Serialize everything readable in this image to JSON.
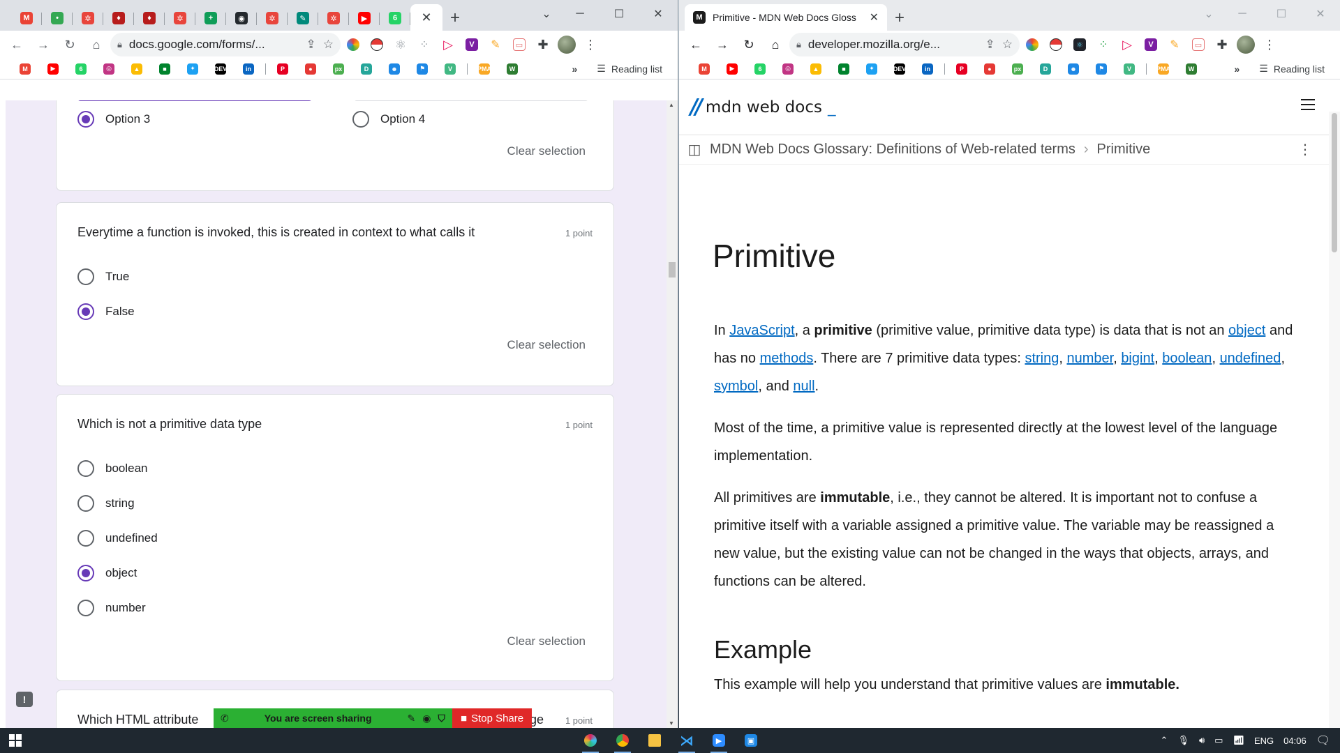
{
  "left_window": {
    "pinned_tabs": [
      {
        "icon": "gmail-icon",
        "color": "#ea4335",
        "glyph": "M"
      },
      {
        "icon": "toggle-icon",
        "color": "#34a853",
        "glyph": "•"
      },
      {
        "icon": "ring-icon",
        "color": "#e8453c",
        "glyph": "✲"
      },
      {
        "icon": "pin-icon",
        "color": "#b71c1c",
        "glyph": "♦"
      },
      {
        "icon": "pin-icon",
        "color": "#b71c1c",
        "glyph": "♦"
      },
      {
        "icon": "ring-icon",
        "color": "#e8453c",
        "glyph": "✲"
      },
      {
        "icon": "sheets-icon",
        "color": "#0f9d58",
        "glyph": "+"
      },
      {
        "icon": "github-icon",
        "color": "#24292e",
        "glyph": "◉"
      },
      {
        "icon": "ring-icon",
        "color": "#e8453c",
        "glyph": "✲"
      },
      {
        "icon": "edit-icon",
        "color": "#00897b",
        "glyph": "✎"
      },
      {
        "icon": "ring-icon",
        "color": "#e8453c",
        "glyph": "✲"
      },
      {
        "icon": "youtube-icon",
        "color": "#ff0000",
        "glyph": "▶"
      },
      {
        "icon": "whatsapp-icon",
        "color": "#25d366",
        "glyph": "6"
      }
    ],
    "url": "docs.google.com/forms/...",
    "reading_list": "Reading list"
  },
  "bookmarks": [
    {
      "icon": "gmail-icon",
      "color": "#ea4335",
      "glyph": "M"
    },
    {
      "icon": "youtube-icon",
      "color": "#ff0000",
      "glyph": "▶"
    },
    {
      "icon": "whatsapp-icon",
      "color": "#25d366",
      "glyph": "6"
    },
    {
      "icon": "instagram-icon",
      "color": "#c13584",
      "glyph": "◎"
    },
    {
      "icon": "drive-icon",
      "color": "#fbbc04",
      "glyph": "▲"
    },
    {
      "icon": "meet-icon",
      "color": "#00832d",
      "glyph": "■"
    },
    {
      "icon": "twitter-icon",
      "color": "#1da1f2",
      "glyph": "✦"
    },
    {
      "icon": "dev-icon",
      "color": "#000000",
      "glyph": "DEV"
    },
    {
      "icon": "linkedin-icon",
      "color": "#0a66c2",
      "glyph": "in"
    },
    {
      "icon": "pinterest-icon",
      "color": "#e60023",
      "glyph": "P"
    },
    {
      "icon": "record-icon",
      "color": "#e53935",
      "glyph": "●"
    },
    {
      "icon": "px-icon",
      "color": "#4caf50",
      "glyph": "px"
    },
    {
      "icon": "dollar-icon",
      "color": "#26a69a",
      "glyph": "D"
    },
    {
      "icon": "robot-icon",
      "color": "#1e88e5",
      "glyph": "☻"
    },
    {
      "icon": "flag-icon",
      "color": "#1e88e5",
      "glyph": "⚑"
    },
    {
      "icon": "vue-icon",
      "color": "#41b883",
      "glyph": "V"
    },
    {
      "icon": "pma-icon",
      "color": "#f9a825",
      "glyph": "PMA"
    },
    {
      "icon": "w-icon",
      "color": "#2e7d32",
      "glyph": "W"
    }
  ],
  "form": {
    "q0": {
      "option3": "Option 3",
      "option4": "Option 4",
      "clear": "Clear selection"
    },
    "q1": {
      "title": "Everytime a function is invoked, this is created in context to what calls it",
      "points": "1 point",
      "options": [
        "True",
        "False"
      ],
      "clear": "Clear selection"
    },
    "q2": {
      "title": "Which is not a primitive data type",
      "points": "1 point",
      "options": [
        "boolean",
        "string",
        "undefined",
        "object",
        "number"
      ],
      "clear": "Clear selection"
    },
    "q3": {
      "title_visible": "Which HTML attribute",
      "title_tail": "ge",
      "points": "1 point"
    }
  },
  "screen_share": {
    "message": "You are screen sharing",
    "stop": "Stop Share"
  },
  "right_window": {
    "tab_title": "Primitive - MDN Web Docs Gloss",
    "url": "developer.mozilla.org/e...",
    "reading_list": "Reading list",
    "logo_text": "mdn web docs",
    "breadcrumb": [
      "MDN Web Docs Glossary: Definitions of Web-related terms",
      "Primitive"
    ],
    "heading": "Primitive",
    "p1": {
      "in": "In ",
      "javascript": "JavaScript",
      "a": ", a ",
      "primitive": "primitive",
      "rest1": " (primitive value, primitive data type) is data that is not an ",
      "object": "object",
      "and_no": " and has no ",
      "methods": "methods",
      "there_are": ". There are 7 primitive data types: ",
      "string": "string",
      "number": "number",
      "bigint": "bigint",
      "boolean": "boolean",
      "undefined": "undefined",
      "symbol": "symbol",
      "and": ", and ",
      "null": "null",
      "comma": ", ",
      "dot": "."
    },
    "p2": "Most of the time, a primitive value is represented directly at the lowest level of the language implementation.",
    "p3": {
      "pre": "All primitives are ",
      "immutable": "immutable",
      "post": ", i.e., they cannot be altered. It is important not to confuse a primitive itself with a variable assigned a primitive value. The variable may be reassigned a new value, but the existing value can not be changed in the ways that objects, arrays, and functions can be altered."
    },
    "h2": "Example",
    "p4": {
      "pre": "This example will help you understand that primitive values are ",
      "immutable": "immutable."
    }
  },
  "taskbar": {
    "lang": "ENG",
    "time": "04:06"
  }
}
